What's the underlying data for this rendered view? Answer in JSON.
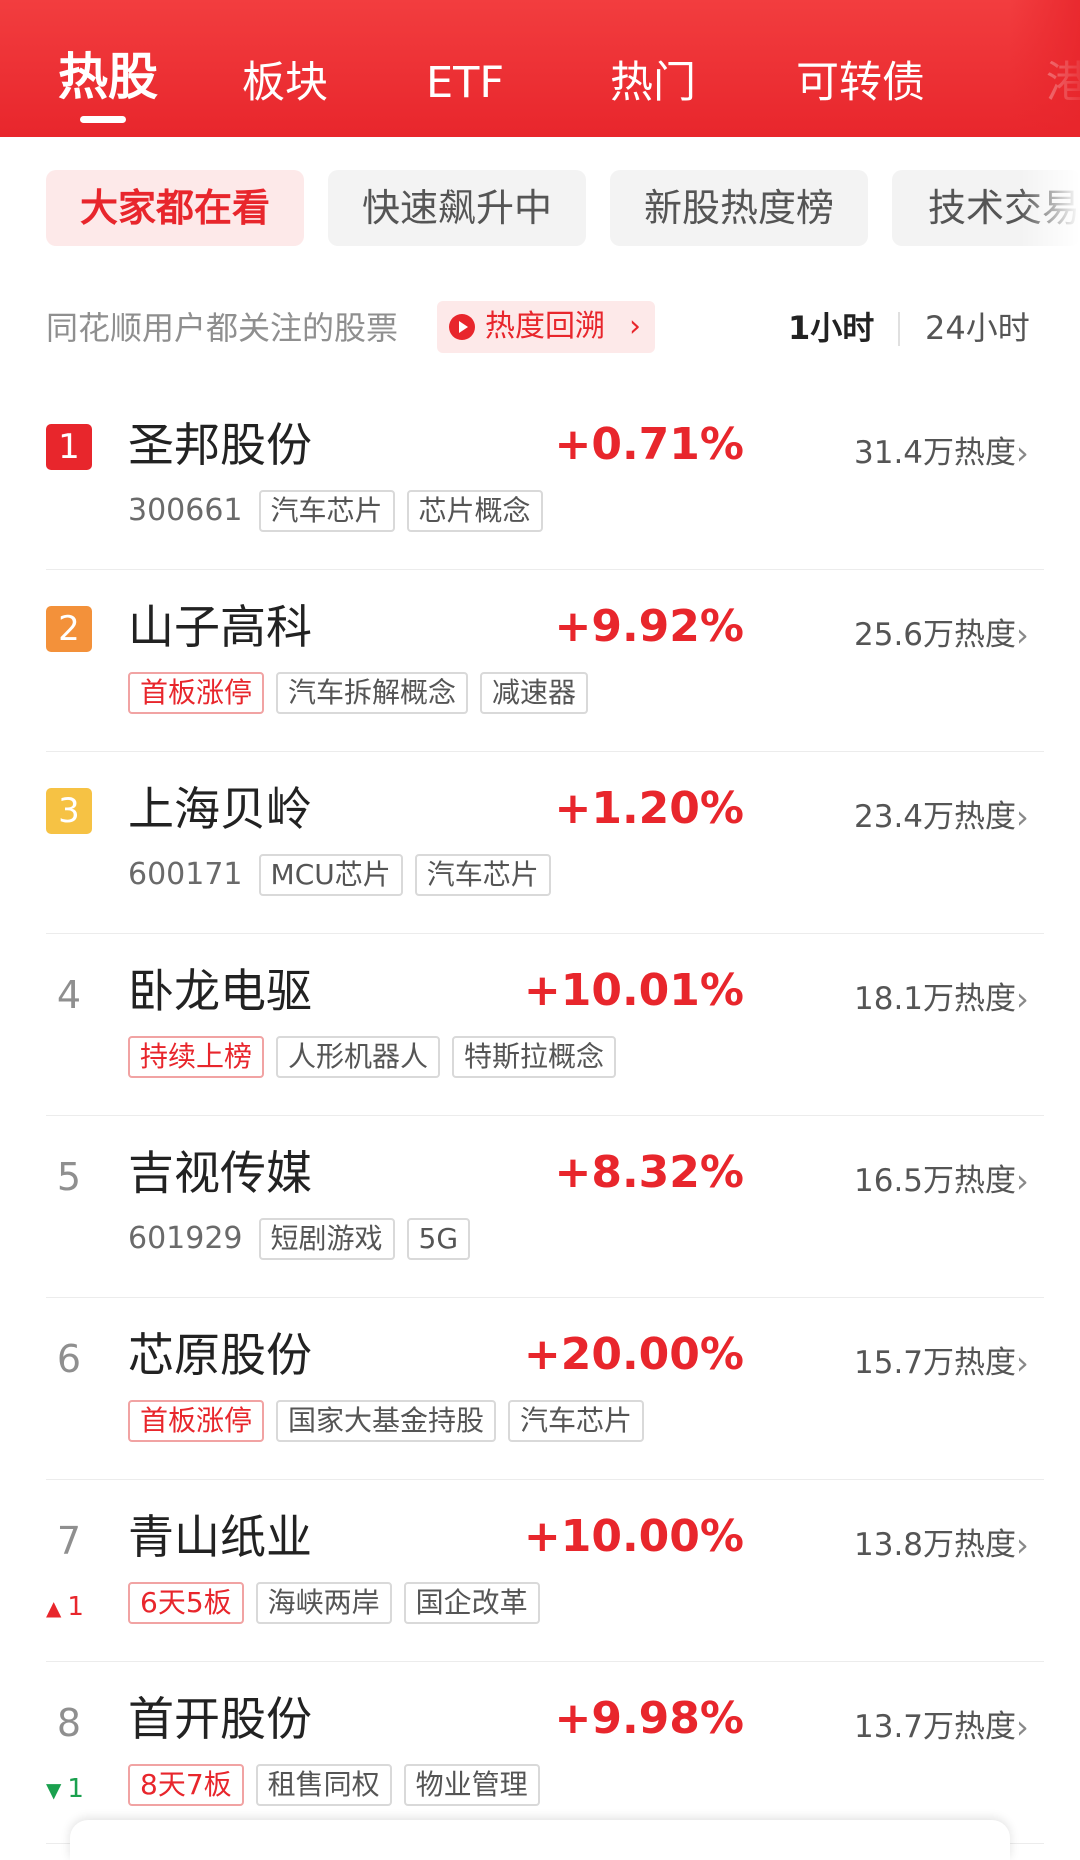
{
  "top_tabs": [
    {
      "label": "热股",
      "active": true
    },
    {
      "label": "板块",
      "active": false
    },
    {
      "label": "ETF",
      "active": false
    },
    {
      "label": "热门",
      "active": false
    },
    {
      "label": "可转债",
      "active": false
    },
    {
      "label": "港",
      "active": false
    }
  ],
  "chips": [
    {
      "label": "大家都在看",
      "active": true
    },
    {
      "label": "快速飙升中",
      "active": false
    },
    {
      "label": "新股热度榜",
      "active": false
    },
    {
      "label": "技术交易",
      "active": false
    }
  ],
  "subtitle": "同花顺用户都关注的股票",
  "replay_button": {
    "label": "热度回溯",
    "icon": "play-icon",
    "chevron": "›"
  },
  "time_toggle": {
    "selected": "1小时",
    "other": "24小时"
  },
  "colors": {
    "accent": "#e8262c",
    "rank1": "#e8262c",
    "rank2": "#f3913a",
    "rank3": "#f6c244",
    "down": "#1aa04e"
  },
  "stocks": [
    {
      "rank": "1",
      "name": "圣邦股份",
      "code": "300661",
      "change": "+0.71%",
      "heat": "31.4万热度",
      "tags": [
        {
          "text": "汽车芯片",
          "red": false
        },
        {
          "text": "芯片概念",
          "red": false
        }
      ]
    },
    {
      "rank": "2",
      "name": "山子高科",
      "code": "",
      "change": "+9.92%",
      "heat": "25.6万热度",
      "tags": [
        {
          "text": "首板涨停",
          "red": true
        },
        {
          "text": "汽车拆解概念",
          "red": false
        },
        {
          "text": "减速器",
          "red": false
        }
      ]
    },
    {
      "rank": "3",
      "name": "上海贝岭",
      "code": "600171",
      "change": "+1.20%",
      "heat": "23.4万热度",
      "tags": [
        {
          "text": "MCU芯片",
          "red": false
        },
        {
          "text": "汽车芯片",
          "red": false
        }
      ]
    },
    {
      "rank": "4",
      "name": "卧龙电驱",
      "code": "",
      "change": "+10.01%",
      "heat": "18.1万热度",
      "tags": [
        {
          "text": "持续上榜",
          "red": true
        },
        {
          "text": "人形机器人",
          "red": false
        },
        {
          "text": "特斯拉概念",
          "red": false
        }
      ]
    },
    {
      "rank": "5",
      "name": "吉视传媒",
      "code": "601929",
      "change": "+8.32%",
      "heat": "16.5万热度",
      "tags": [
        {
          "text": "短剧游戏",
          "red": false
        },
        {
          "text": "5G",
          "red": false
        }
      ]
    },
    {
      "rank": "6",
      "name": "芯原股份",
      "code": "",
      "change": "+20.00%",
      "heat": "15.7万热度",
      "tags": [
        {
          "text": "首板涨停",
          "red": true
        },
        {
          "text": "国家大基金持股",
          "red": false
        },
        {
          "text": "汽车芯片",
          "red": false
        }
      ]
    },
    {
      "rank": "7",
      "name": "青山纸业",
      "code": "",
      "change": "+10.00%",
      "heat": "13.8万热度",
      "trend": {
        "dir": "up",
        "symbol": "▲",
        "value": "1"
      },
      "tags": [
        {
          "text": "6天5板",
          "red": true
        },
        {
          "text": "海峡两岸",
          "red": false
        },
        {
          "text": "国企改革",
          "red": false
        }
      ]
    },
    {
      "rank": "8",
      "name": "首开股份",
      "code": "",
      "change": "+9.98%",
      "heat": "13.7万热度",
      "trend": {
        "dir": "down",
        "symbol": "▼",
        "value": "1"
      },
      "tags": [
        {
          "text": "8天7板",
          "red": true
        },
        {
          "text": "租售同权",
          "red": false
        },
        {
          "text": "物业管理",
          "red": false
        }
      ]
    }
  ]
}
